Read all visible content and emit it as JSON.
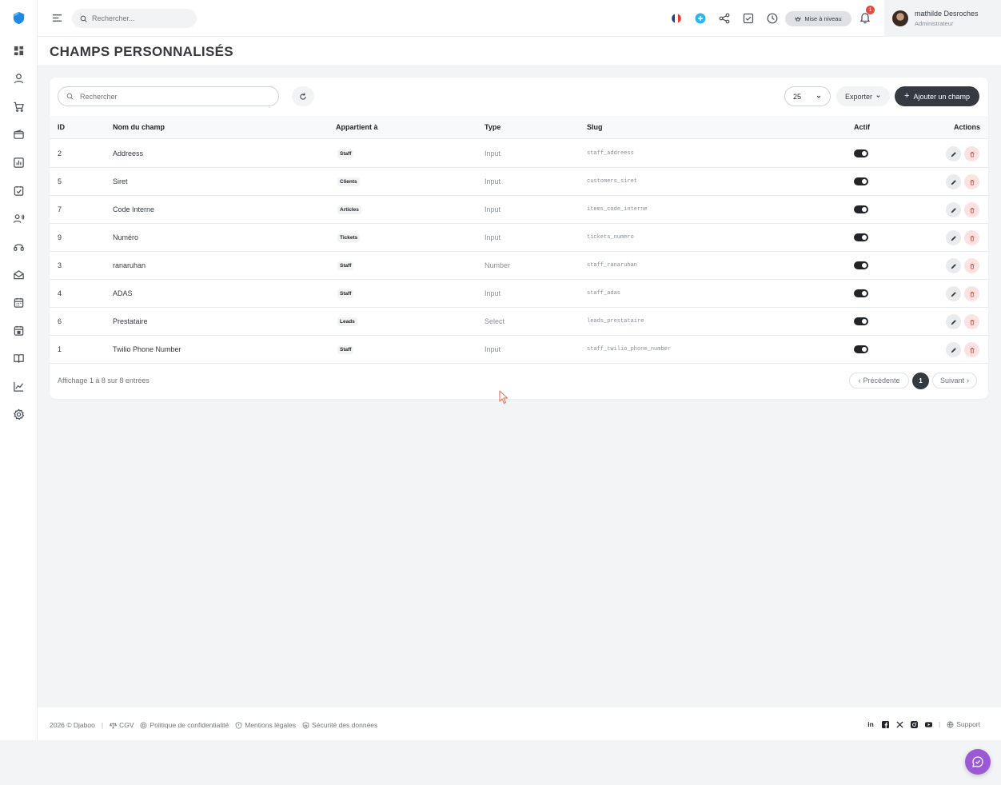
{
  "topbar": {
    "search_placeholder": "Rechercher...",
    "upgrade_label": "Mise à niveau",
    "notif_count": "1",
    "user_name": "mathilde Desroches",
    "user_role": "Administrateur"
  },
  "page": {
    "title": "CHAMPS PERSONNALISÉS"
  },
  "toolbar": {
    "search_placeholder": "Rechercher",
    "per_page": "25",
    "export_label": "Exporter",
    "add_label": "Ajouter un champ"
  },
  "table": {
    "headers": {
      "id": "ID",
      "name": "Nom du champ",
      "belongs": "Appartient à",
      "type": "Type",
      "slug": "Slug",
      "active": "Actif",
      "actions": "Actions"
    },
    "rows": [
      {
        "id": "2",
        "name": "Addreess",
        "belongs": "Staff",
        "type": "Input",
        "slug": "staff_addreess",
        "active": true
      },
      {
        "id": "5",
        "name": "Siret",
        "belongs": "Clients",
        "type": "Input",
        "slug": "customers_siret",
        "active": true
      },
      {
        "id": "7",
        "name": "Code Interne",
        "belongs": "Articles",
        "type": "Input",
        "slug": "items_code_interne",
        "active": true
      },
      {
        "id": "9",
        "name": "Numéro",
        "belongs": "Tickets",
        "type": "Input",
        "slug": "tickets_numero",
        "active": true
      },
      {
        "id": "3",
        "name": "ranaruhan",
        "belongs": "Staff",
        "type": "Number",
        "slug": "staff_ranaruhan",
        "active": true
      },
      {
        "id": "4",
        "name": "ADAS",
        "belongs": "Staff",
        "type": "Input",
        "slug": "staff_adas",
        "active": true
      },
      {
        "id": "6",
        "name": "Prestataire",
        "belongs": "Leads",
        "type": "Select",
        "slug": "leads_prestataire",
        "active": true
      },
      {
        "id": "1",
        "name": "Twilio Phone Number",
        "belongs": "Staff",
        "type": "Input",
        "slug": "staff_twilio_phone_number",
        "active": true
      }
    ]
  },
  "pagination": {
    "info": "Affichage 1 à 8 sur 8 entrées",
    "prev": "Précédente",
    "current": "1",
    "next": "Suivant"
  },
  "footer": {
    "copyright": "2026 © Djaboo",
    "cgv": "CGV",
    "privacy": "Politique de confidentialité",
    "legal": "Mentions légales",
    "security": "Sécurité des données",
    "support": "Support"
  },
  "colors": {
    "accent_dark": "#343a40",
    "logo_blue": "#1e88e5",
    "danger": "#e74c3c",
    "chat_purple": "#9b59d6"
  }
}
